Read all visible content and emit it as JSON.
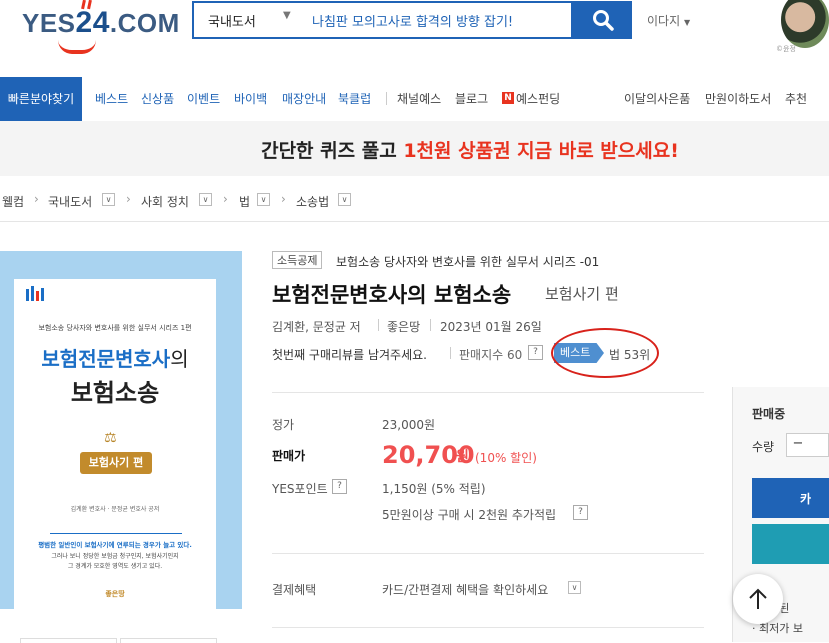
{
  "header": {
    "logo_text": "YES",
    "logo_num": "24",
    "logo_suffix": ".COM",
    "search_category": "국내도서",
    "search_text": "나침판 모의고사로 합격의 방향 잡기!",
    "more_label": "이다지",
    "avatar_caption": "©윤정"
  },
  "nav": {
    "quick_label": "빠른분야찾기",
    "items_blue": [
      "베스트",
      "신상품",
      "이벤트",
      "바이백",
      "매장안내",
      "북클럽"
    ],
    "items_gray": [
      "채널예스",
      "블로그"
    ],
    "funding_badge": "N",
    "funding_label": "예스펀딩",
    "right_items": [
      "이달의사은품",
      "만원이하도서",
      "추천"
    ]
  },
  "banner": {
    "part1": "간단한 퀴즈 풀고 ",
    "part2": "1천원 상품권 지금 바로 받으세요!"
  },
  "breadcrumb": [
    "웰컴",
    "국내도서",
    "사회 정치",
    "법",
    "소송법"
  ],
  "cover": {
    "series": "보험소송 당사자와 변호사를 위한 실무서 시리즈 1편",
    "title1": "보험전문변호사",
    "title1_suffix": "의",
    "title2": "보험소송",
    "edition": "보험사기 편",
    "authors": "김계환 변호사 · 문정균 변호사 공저",
    "tag1": "평범한 일반인이 보험사기에 연루되는 경우가 늘고 있다.",
    "tag2": "그러나 보니 정당한 보험금 청구인지, 보험사기인지",
    "tag3": "그 경계가 모호한 영역도 생기고 있다.",
    "publisher": "좋은땅"
  },
  "product": {
    "tag": "소득공제",
    "series": "보험소송 당사자와 변호사를 위한 실무서 시리즈 -01",
    "title": "보험전문변호사의 보험소송",
    "subtitle": "보험사기 편",
    "authors": "김계환, 문정균 저",
    "publisher": "좋은땅",
    "date": "2023년 01월 26일",
    "review": "첫번째 구매리뷰를 남겨주세요.",
    "sales_index": "판매지수 60",
    "best_label": "베스트",
    "rank": "법 53위"
  },
  "price": {
    "list_label": "정가",
    "list_value": "23,000원",
    "sale_label": "판매가",
    "sale_value": "20,700",
    "sale_unit": "원",
    "discount": "(10% 할인)",
    "point_label": "YES포인트",
    "point_value": "1,150원 (5% 적립)",
    "extra_point": "5만원이상 구매 시 2천원 추가적립",
    "benefit_label": "결제혜택",
    "benefit_value": "카드/간편결제 혜택을 확인하세요"
  },
  "panel": {
    "status": "판매중",
    "qty_label": "수량",
    "minus": "−",
    "cart_char": "카",
    "note1": "· 배송된",
    "note2": "· 최저가 보"
  },
  "icons": {
    "help": "?",
    "dropdown": "∨"
  }
}
